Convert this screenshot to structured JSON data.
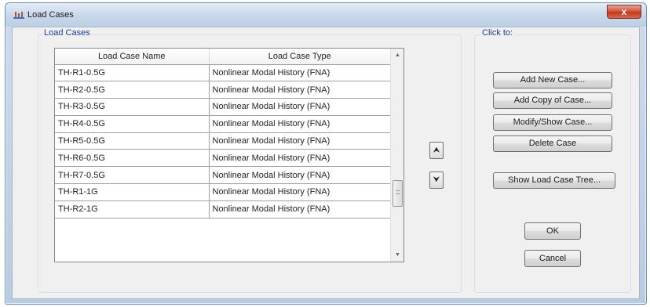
{
  "window": {
    "title": "Load Cases",
    "close_glyph": "x"
  },
  "load_cases_group": {
    "label": "Load Cases",
    "columns": [
      "Load Case Name",
      "Load Case Type"
    ],
    "rows": [
      {
        "name": "TH-R1-0.5G",
        "type": "Nonlinear Modal History (FNA)"
      },
      {
        "name": "TH-R2-0.5G",
        "type": "Nonlinear Modal History (FNA)"
      },
      {
        "name": "TH-R3-0.5G",
        "type": "Nonlinear Modal History (FNA)"
      },
      {
        "name": "TH-R4-0.5G",
        "type": "Nonlinear Modal History (FNA)"
      },
      {
        "name": "TH-R5-0.5G",
        "type": "Nonlinear Modal History (FNA)"
      },
      {
        "name": "TH-R6-0.5G",
        "type": "Nonlinear Modal History (FNA)"
      },
      {
        "name": "TH-R7-0.5G",
        "type": "Nonlinear Modal History (FNA)"
      },
      {
        "name": "TH-R1-1G",
        "type": "Nonlinear Modal History (FNA)"
      },
      {
        "name": "TH-R2-1G",
        "type": "Nonlinear Modal History (FNA)"
      }
    ],
    "move_up_glyph": "⮝",
    "move_down_glyph": "⮟"
  },
  "click_to_group": {
    "label": "Click to:",
    "buttons": {
      "add_new": "Add New Case...",
      "add_copy": "Add Copy of Case...",
      "modify_show": "Modify/Show Case...",
      "delete": "Delete Case",
      "show_tree": "Show Load Case Tree..."
    }
  },
  "dialog_buttons": {
    "ok": "OK",
    "cancel": "Cancel"
  }
}
